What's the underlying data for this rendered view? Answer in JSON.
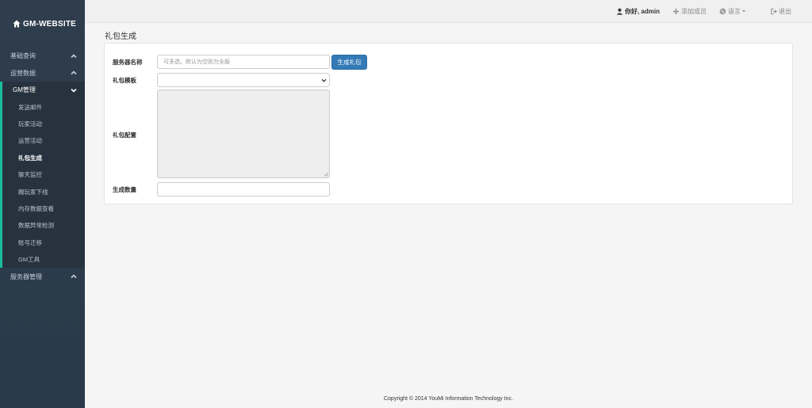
{
  "brand": {
    "title": "GM-WEBSITE"
  },
  "sidebar": {
    "items": [
      {
        "label": "基础查询"
      },
      {
        "label": "运营数据"
      },
      {
        "label": "GM管理"
      }
    ],
    "sub": [
      {
        "label": "发送邮件"
      },
      {
        "label": "玩家活动"
      },
      {
        "label": "运营活动"
      },
      {
        "label": "礼包生成"
      },
      {
        "label": "聊天监控"
      },
      {
        "label": "踢玩家下线"
      },
      {
        "label": "内存数据查看"
      },
      {
        "label": "数据异常检测"
      },
      {
        "label": "账号迁移"
      },
      {
        "label": "GM工具"
      }
    ],
    "server": {
      "label": "服务器管理"
    }
  },
  "topbar": {
    "user": "你好, admin",
    "add_member": "添加成员",
    "language": "语言",
    "logout": "退出"
  },
  "page": {
    "title": "礼包生成"
  },
  "form": {
    "server_label": "服务器名称",
    "server_placeholder": "可多选，默认为空则为全服",
    "generate_button": "生成礼包",
    "template_label": "礼包模板",
    "config_label": "礼包配置",
    "count_label": "生成数量"
  },
  "footer": {
    "copyright": "Copyright © 2014 YouMi Information Technology Inc."
  },
  "colors": {
    "sidebar": "#2f3d4c",
    "accent": "#1abc9c",
    "primary": "#337ab7"
  }
}
